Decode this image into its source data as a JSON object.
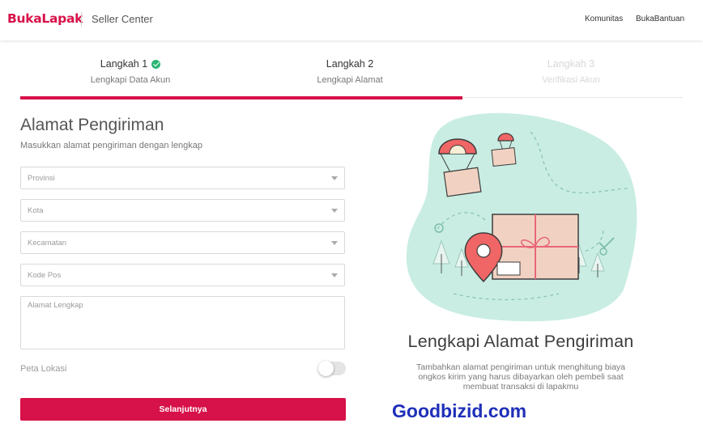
{
  "header": {
    "logo": "BukaLapak",
    "title": "Seller Center",
    "links": [
      "Komunitas",
      "BukaBantuan"
    ]
  },
  "steps": [
    {
      "title": "Langkah 1",
      "subtitle": "Lengkapi Data Akun",
      "status": "done"
    },
    {
      "title": "Langkah 2",
      "subtitle": "Lengkapi Alamat",
      "status": "active"
    },
    {
      "title": "Langkah 3",
      "subtitle": "Verifikasi Akun",
      "status": "disabled"
    }
  ],
  "form": {
    "title": "Alamat Pengiriman",
    "subtitle": "Masukkan alamat pengiriman dengan lengkap",
    "fields": {
      "provinsi": "Provinsi",
      "kota": "Kota",
      "kecamatan": "Kecamatan",
      "kode_pos": "Kode Pos",
      "alamat": "Alamat Lengkap"
    },
    "map_label": "Peta Lokasi",
    "map_enabled": false,
    "submit": "Selanjutnya"
  },
  "info": {
    "title": "Lengkapi Alamat Pengiriman",
    "description": "Tambahkan alamat pengiriman untuk menghitung biaya ongkos kirim yang harus dibayarkan oleh pembeli saat membuat transaksi di lapakmu"
  },
  "watermark": "Goodbizid.com",
  "colors": {
    "brand": "#d71149",
    "success": "#2bb673",
    "illustration_bg": "#c9ede3"
  }
}
